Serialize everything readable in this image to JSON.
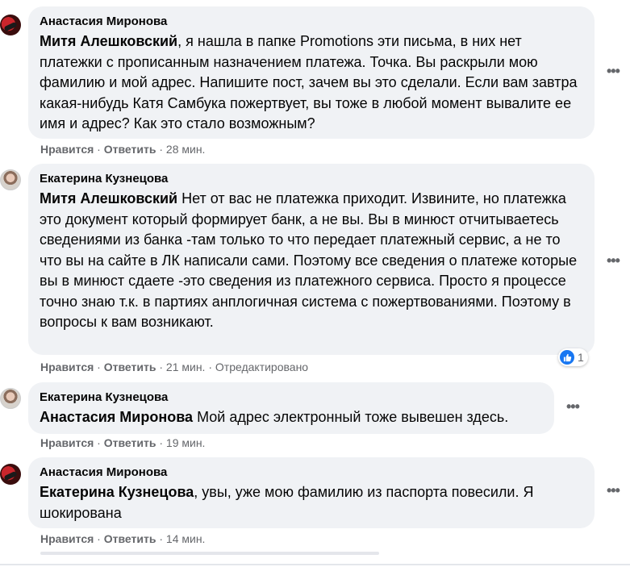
{
  "comments": [
    {
      "author": "Анастасия Миронова",
      "mention": "Митя Алешковский",
      "text": ", я нашла в папке Promotions эти письма, в них нет платежки с прописанным назначением платежа. Точка. Вы раскрыли мою фамилию и мой адрес. Напишите пост, зачем вы это сделали. Если вам завтра какая-нибудь Катя Самбука пожертвует, вы тоже в любой момент вывалите ее имя и адрес? Как это стало возможным?",
      "like": "Нравится",
      "reply": "Ответить",
      "time": "28 мин."
    },
    {
      "author": "Екатерина Кузнецова",
      "mention": "Митя Алешковский",
      "text": " Нет от вас не платежка приходит. Извините, но платежка это документ который формирует банк, а не вы. Вы в минюст отчитываетесь сведениями из банка -там только то что передает платежный сервис, а не то что вы на сайте в ЛК написали сами. Поэтому все сведения о платеже которые вы в минюст сдаете -это сведения из платежного сервиса. Просто я процессе точно знаю т.к. в партиях анплогичная система с пожертвованиями. Поэтому в вопросы к вам возникают.",
      "like": "Нравится",
      "reply": "Ответить",
      "time": "21 мин.",
      "edited": "Отредактировано",
      "reaction_count": "1"
    },
    {
      "author": "Екатерина Кузнецова",
      "mention": "Анастасия Миронова",
      "text": " Мой адрес электронный тоже вывешен здесь.",
      "like": "Нравится",
      "reply": "Ответить",
      "time": "19 мин."
    },
    {
      "author": "Анастасия Миронова",
      "mention": "Екатерина Кузнецова",
      "text": ", увы, уже мою фамилию из паспорта повесили. Я шокирована",
      "like": "Нравится",
      "reply": "Ответить",
      "time": "14 мин."
    }
  ],
  "separator": " · ",
  "more_icon": "more-dots-icon",
  "like_reaction_icon": "thumbs-up-icon",
  "colors": {
    "bubble": "#f0f2f5",
    "meta": "#65676b",
    "like": "#1877f2"
  }
}
